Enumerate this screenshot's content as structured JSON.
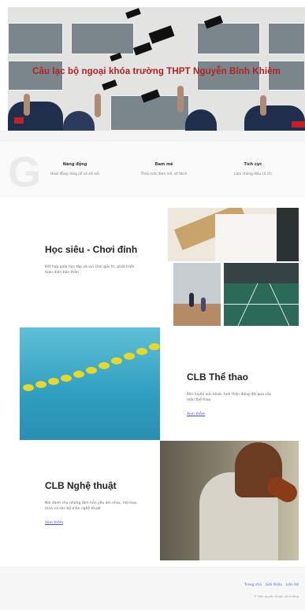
{
  "hero": {
    "title": "Câu lạc bộ ngoại khóa trường THPT Nguyễn Bỉnh Khiêm"
  },
  "features": {
    "watermark": "G",
    "items": [
      {
        "title": "Năng động",
        "desc": "Hoạt động năng nổ và sôi nổi"
      },
      {
        "title": "Đam mê",
        "desc": "Thoả mãn đam mê, sở thích"
      },
      {
        "title": "Tích cực",
        "desc": "Làm những điều có ích"
      }
    ]
  },
  "sections": [
    {
      "title": "Học siêu - Chơi đỉnh",
      "desc": "Kết hợp giữa học tập và vui chơi giải trí, phát triển toàn diện bản thân",
      "link": ""
    },
    {
      "title": "CLB Thể thao",
      "desc": "Rèn luyện sức khoẻ, tinh thần đồng đội qua các môn thể thao",
      "link": "Xem thêm"
    },
    {
      "title": "CLB Nghệ thuật",
      "desc": "Nơi dành cho những tâm hồn yêu âm nhạc, hội hoạ, múa và các bộ môn nghệ thuật",
      "link": "Xem thêm"
    }
  ],
  "footer": {
    "links": [
      "Trang chủ",
      "Giới thiệu",
      "Liên hệ"
    ],
    "copyright": "© Bản quyền thuộc về trường"
  },
  "colors": {
    "hero_title": "#b22222",
    "link": "#3b5bdb"
  }
}
